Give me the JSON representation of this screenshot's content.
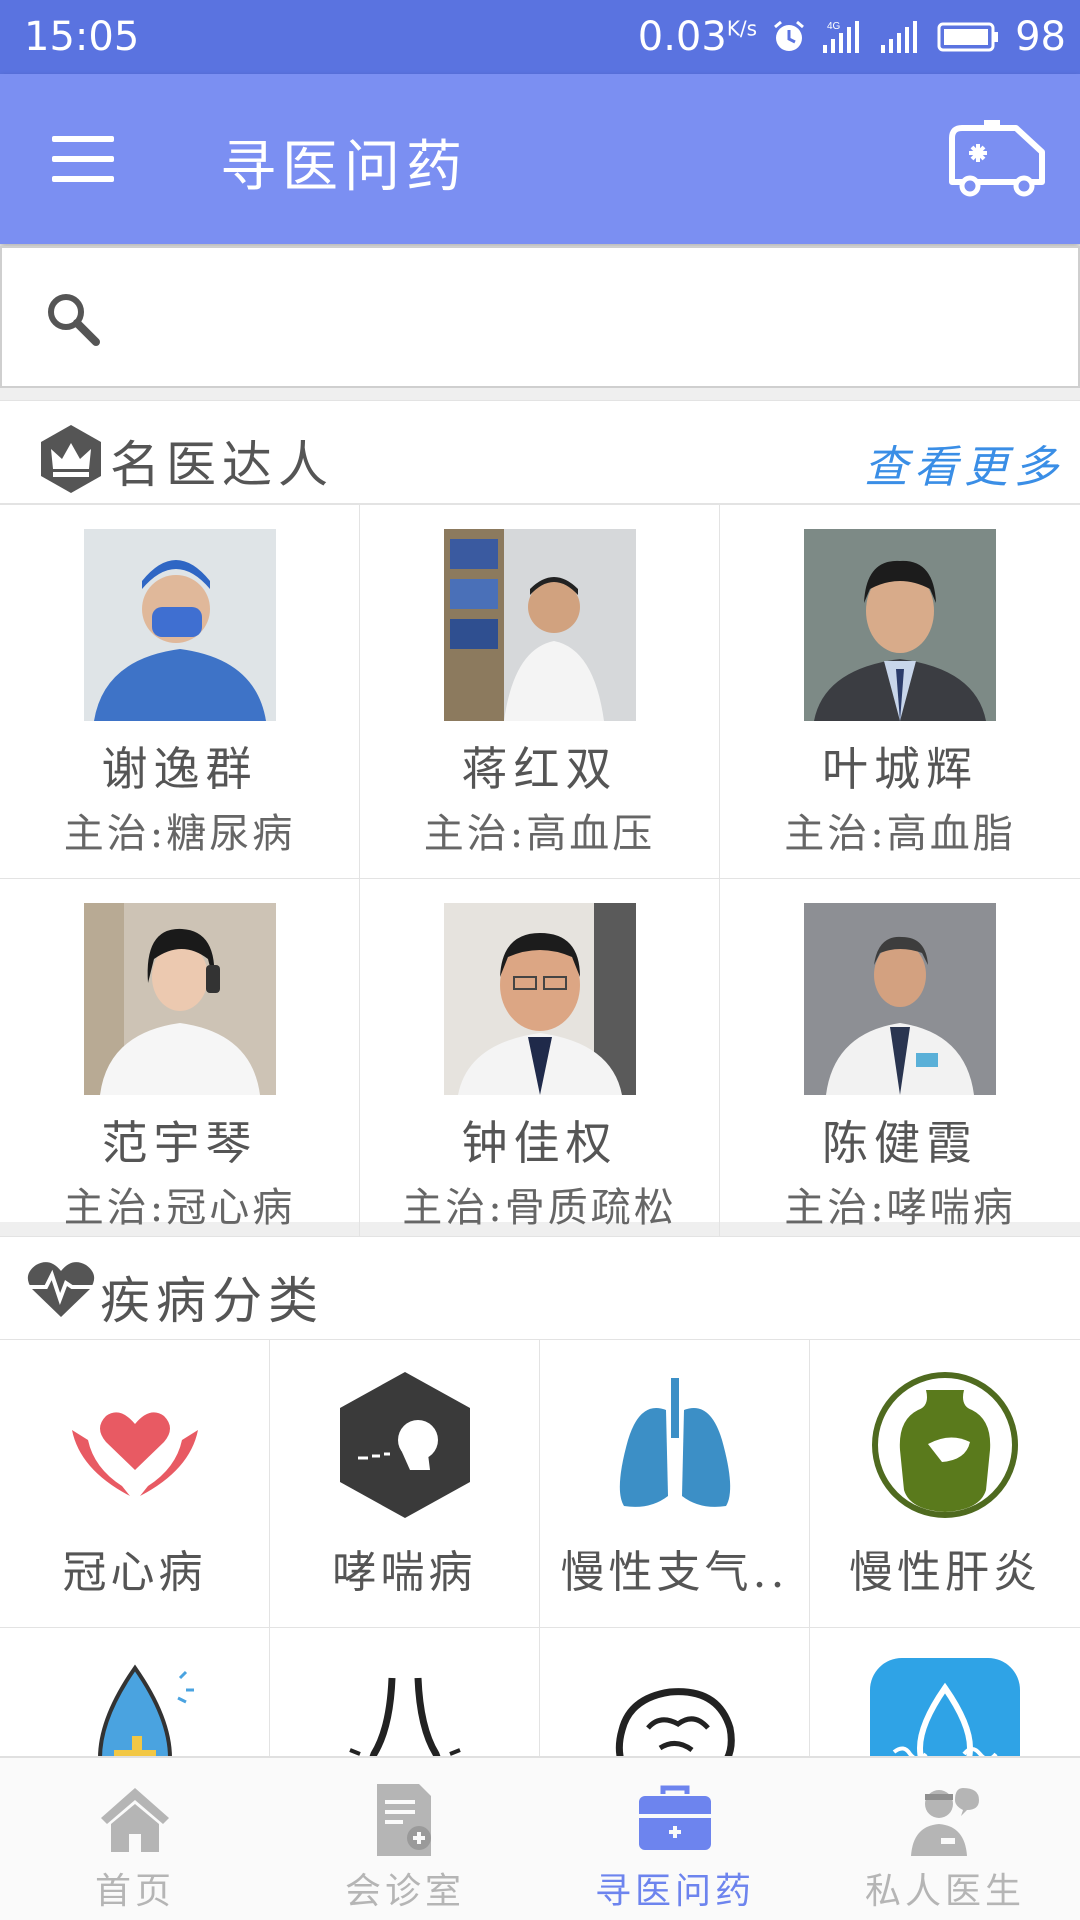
{
  "status_bar": {
    "time": "15:05",
    "net_speed": "0.03",
    "net_unit": "K/s",
    "network": "4G",
    "battery": "98"
  },
  "app_bar": {
    "title": "寻医问药"
  },
  "search": {
    "placeholder": ""
  },
  "famous_doctors": {
    "title": "名医达人",
    "more": "查看更多",
    "doctors": [
      {
        "name": "谢逸群",
        "specialty": "主治:糖尿病"
      },
      {
        "name": "蒋红双",
        "specialty": "主治:高血压"
      },
      {
        "name": "叶城辉",
        "specialty": "主治:高血脂"
      },
      {
        "name": "范宇琴",
        "specialty": "主治:冠心病"
      },
      {
        "name": "钟佳权",
        "specialty": "主治:骨质疏松"
      },
      {
        "name": "陈健霞",
        "specialty": "主治:哮喘病"
      }
    ]
  },
  "disease_categories": {
    "title": "疾病分类",
    "items": [
      {
        "label": "冠心病",
        "icon": "heart-hands-icon"
      },
      {
        "label": "哮喘病",
        "icon": "cough-icon"
      },
      {
        "label": "慢性支气..",
        "icon": "lungs-icon"
      },
      {
        "label": "慢性肝炎",
        "icon": "liver-icon"
      },
      {
        "label": "",
        "icon": "blood-drop-icon"
      },
      {
        "label": "",
        "icon": "nose-icon"
      },
      {
        "label": "",
        "icon": "brain-icon"
      },
      {
        "label": "",
        "icon": "water-drop-icon"
      }
    ]
  },
  "tab_bar": {
    "tabs": [
      {
        "label": "首页",
        "icon": "home-icon",
        "active": false
      },
      {
        "label": "会诊室",
        "icon": "report-icon",
        "active": false
      },
      {
        "label": "寻医问药",
        "icon": "medical-kit-icon",
        "active": true
      },
      {
        "label": "私人医生",
        "icon": "doctor-icon",
        "active": false
      }
    ]
  },
  "colors": {
    "status_bar": "#5a73e0",
    "app_bar": "#7b8ff2",
    "accent": "#3a8ee6",
    "active_tab": "#6d84ee"
  }
}
